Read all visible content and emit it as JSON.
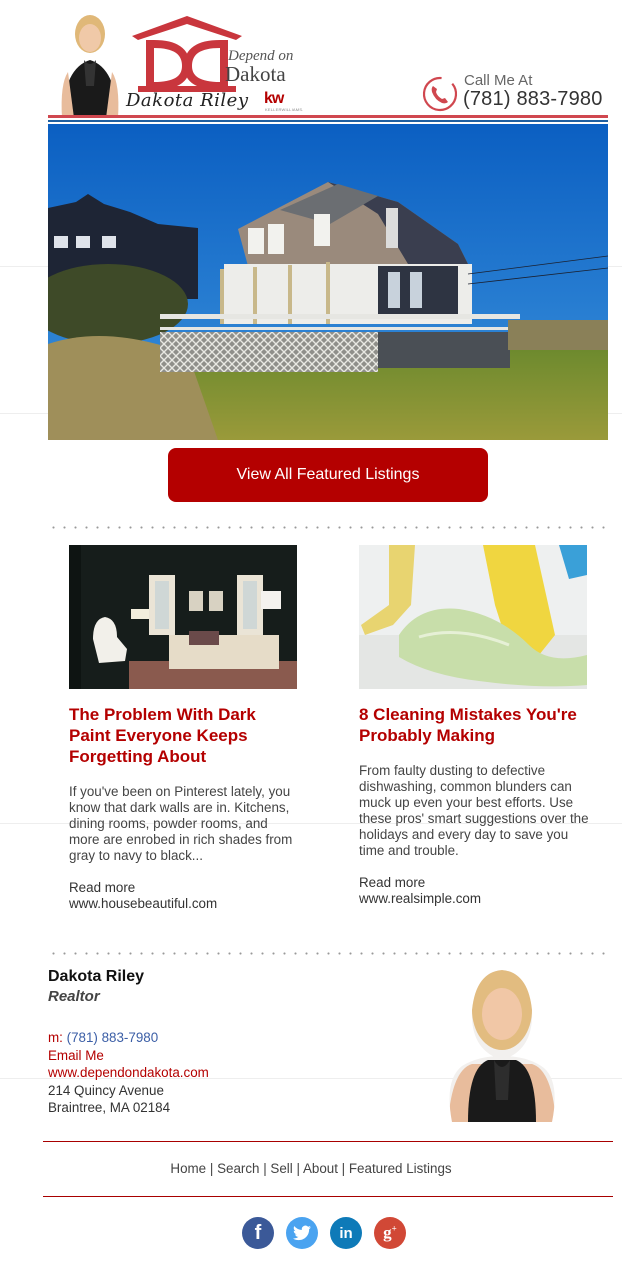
{
  "header": {
    "logo_line1": "Depend on",
    "logo_line2": "Dakota",
    "signature": "Dakota Riley",
    "brokerage_mark": "kw",
    "brokerage_name": "KELLERWILLIAMS.",
    "call_label": "Call Me At",
    "call_number": "(781) 883-7980",
    "icons": {
      "phone": "phone-icon"
    }
  },
  "hero": {
    "image_alt": "Shingled gambrel-roof house with white porch and lattice on a grassy lot under blue sky"
  },
  "cta": {
    "label": "View All Featured Listings"
  },
  "articles": [
    {
      "image_alt": "Living room with dark glossy walls, white egg chair, cream sofa and patterned rug",
      "title": "The Problem With Dark Paint Everyone Keeps Forgetting About",
      "body": "If you've been on Pinterest lately, you know that dark walls are in. Kitchens, dining rooms, powder rooms, and more are enrobed in rich shades from gray to navy to black...",
      "read_more": "Read more",
      "source": "www.housebeautiful.com"
    },
    {
      "image_alt": "Yellow rubber-gloved hand wiping a surface with a green cloth",
      "title": "8 Cleaning Mistakes You're Probably Making",
      "body": "From faulty dusting to defective dishwashing, common blunders can muck up even your best efforts. Use these pros' smart suggestions over the holidays and every day to save you time and trouble.",
      "read_more": "Read more",
      "source": "www.realsimple.com"
    }
  ],
  "contact": {
    "name": "Dakota Riley",
    "role": "Realtor",
    "phone_prefix": "m: ",
    "phone": "(781) 883-7980",
    "email_label": "Email Me",
    "website": "www.dependondakota.com",
    "address_line1": "214 Quincy Avenue",
    "address_line2": "Braintree, MA 02184"
  },
  "footer": {
    "nav": [
      "Home",
      "Search",
      "Sell",
      "About",
      "Featured Listings"
    ],
    "separator": " | ",
    "social": [
      {
        "name": "facebook",
        "glyph": "f",
        "color": "#3b5998"
      },
      {
        "name": "twitter",
        "glyph": "t",
        "color": "#4aa3f0"
      },
      {
        "name": "linkedin",
        "glyph": "in",
        "color": "#0e7ab8"
      },
      {
        "name": "google-plus",
        "glyph": "g+",
        "color": "#d14836"
      }
    ]
  },
  "colors": {
    "brand_red": "#b40000",
    "link_blue": "#3b5ea6",
    "header_blue": "#1f5fa0"
  }
}
